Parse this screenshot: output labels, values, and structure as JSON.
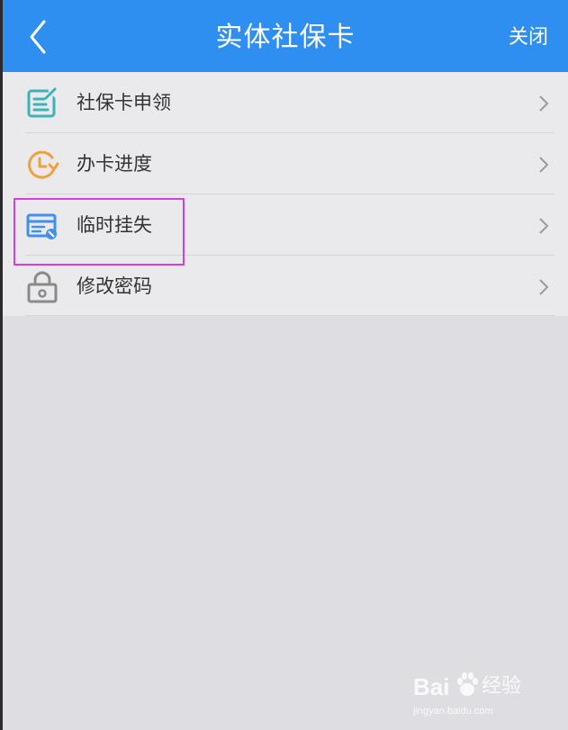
{
  "header": {
    "title": "实体社保卡",
    "close_label": "关闭",
    "back_icon": "back-arrow-icon",
    "color": "#2f8ff0"
  },
  "menu": {
    "items": [
      {
        "label": "社保卡申领",
        "icon": "application-form-icon",
        "icon_color": "#3cb3b9"
      },
      {
        "label": "办卡进度",
        "icon": "progress-clock-icon",
        "icon_color": "#f0a03c"
      },
      {
        "label": "临时挂失",
        "icon": "card-loss-icon",
        "icon_color": "#3f8ff0"
      },
      {
        "label": "修改密码",
        "icon": "lock-icon",
        "icon_color": "#8a8a8a"
      }
    ],
    "chevron_icon": "chevron-right-icon"
  },
  "annotation": {
    "highlight_color": "#d23fd8"
  },
  "watermark": {
    "brand": "Bai",
    "brand_suffix": "经验",
    "url": "jingyan.baidu.com"
  }
}
